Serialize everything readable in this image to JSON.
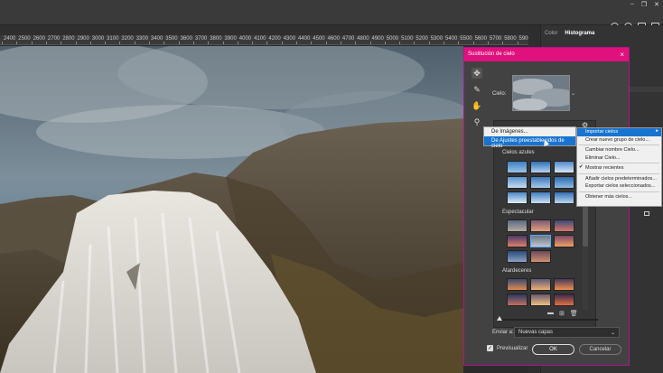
{
  "ruler": {
    "ticks": [
      "2400",
      "2500",
      "2600",
      "2700",
      "2800",
      "2900",
      "3000",
      "3100",
      "3200",
      "3300",
      "3400",
      "3500",
      "3600",
      "3700",
      "3800",
      "3900",
      "4000",
      "4100",
      "4200",
      "4300",
      "4400",
      "4500",
      "4600",
      "4700",
      "4800",
      "4900",
      "5000",
      "5100",
      "5200",
      "5300",
      "5400",
      "5500",
      "5600",
      "5700",
      "5800",
      "5900"
    ]
  },
  "panels": {
    "tabs": [
      "Color",
      "Histograma"
    ],
    "active_tab": "Histograma"
  },
  "dialog": {
    "title": "Sustitución de cielo",
    "close_icon": "×",
    "sky_label": "Cielo:",
    "groups": [
      {
        "label": "Cielos azules"
      },
      {
        "label": "Espectacular"
      },
      {
        "label": "Atardeceres"
      }
    ],
    "output_label": "Enviar a:",
    "output_value": "Nuevas capas",
    "preview_label": "Previsualizar",
    "ok_label": "OK",
    "cancel_label": "Cancelar"
  },
  "menu_import": {
    "items": [
      {
        "label": "De Imágenes...",
        "highlighted": false
      },
      {
        "label": "De Ajustes preestablecidos de cielo",
        "highlighted": true
      }
    ]
  },
  "menu_gear": {
    "items": [
      {
        "label": "Importar cielos",
        "highlighted": true,
        "submenu": true
      },
      {
        "label": "Crear nuevo grupo de cielo..."
      },
      {
        "sep": true
      },
      {
        "label": "Cambiar nombre Cielo..."
      },
      {
        "label": "Eliminar Cielo..."
      },
      {
        "sep": true
      },
      {
        "label": "Mostrar recientes",
        "checked": true
      },
      {
        "sep": true
      },
      {
        "label": "Añadir cielos predeterminados..."
      },
      {
        "label": "Exportar cielos seleccionados..."
      },
      {
        "sep": true
      },
      {
        "label": "Obtener más cielos..."
      }
    ]
  },
  "icons": {
    "tools": [
      "move-sky-icon",
      "sky-brush-icon",
      "hand-icon",
      "zoom-icon"
    ],
    "top": [
      "user-icon",
      "search-icon",
      "workspace-icon",
      "share-icon"
    ]
  }
}
